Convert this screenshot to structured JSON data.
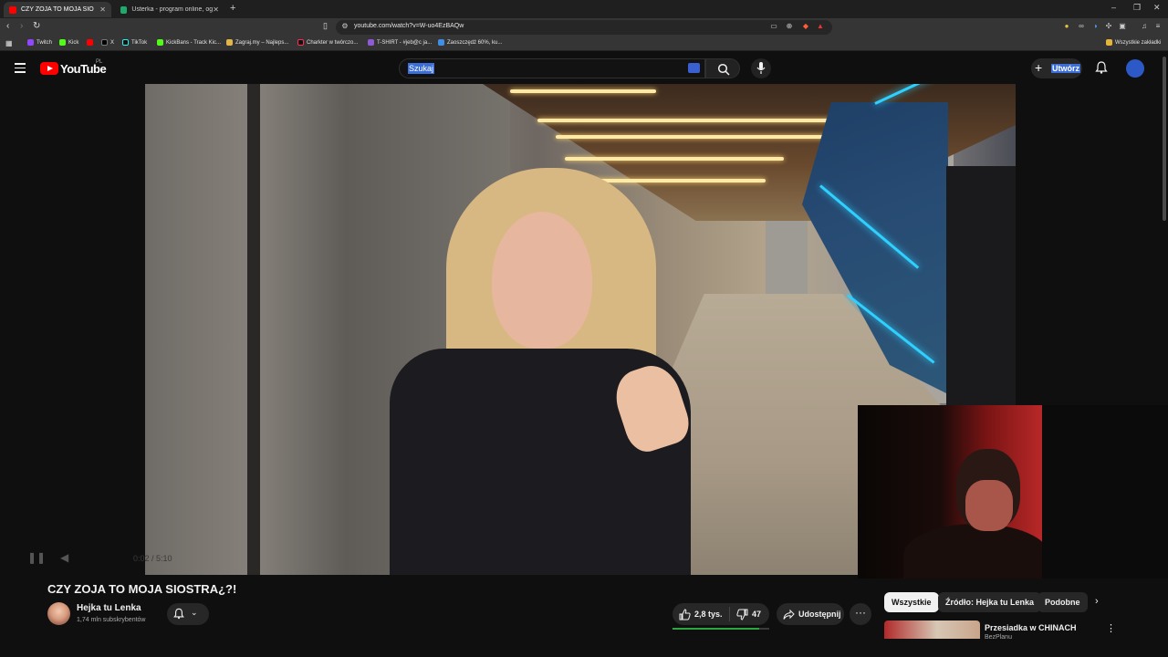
{
  "browser": {
    "tabs": [
      {
        "label": "CZY ZOJA TO MOJA SIOSTRA",
        "active": true
      },
      {
        "label": "Usterka - program online, oglądaj na",
        "active": false
      }
    ],
    "new_tab": "+",
    "url": "youtube.com/watch?v=W-uo4EzBAQw",
    "bookmarks": [
      "Twitch",
      "Kick",
      "X",
      "TikTok",
      "KickBans - Track Kic...",
      "Zagraj.my – Najleps...",
      "Charkter w twórczo...",
      "T-SHIRT - #jeb@c ja...",
      "Zaoszczędź 60%, ku..."
    ],
    "bookmarks_all": "Wszystkie zakładki"
  },
  "youtube": {
    "logo_text": "YouTube",
    "region": "PL",
    "search_text": "Szukaj",
    "create_label": "Utwórz",
    "create_plus": "+"
  },
  "video": {
    "title": "CZY ZOJA TO MOJA SIOSTRA¿?!",
    "player_time": "0:02 / 5:10"
  },
  "channel": {
    "name": "Hejka tu Lenka",
    "subscribers": "1,74 mln subskrybentów",
    "chevron": "⌄"
  },
  "actions": {
    "likes": "2,8 tys.",
    "dislikes": "47",
    "share": "Udostępnij",
    "more": "···",
    "like_ratio": 0.9
  },
  "chips": [
    "Wszystkie",
    "Źródło: Hejka tu Lenka",
    "Podobne"
  ],
  "chip_next": "›",
  "recommendation": {
    "title": "Przesiadka w CHINACH",
    "channel": "BezPlanu",
    "more": "⋮"
  },
  "colors": {
    "accent_red": "#ff0000",
    "selection_blue": "#3b6ed9",
    "like_green": "#2ba640"
  }
}
